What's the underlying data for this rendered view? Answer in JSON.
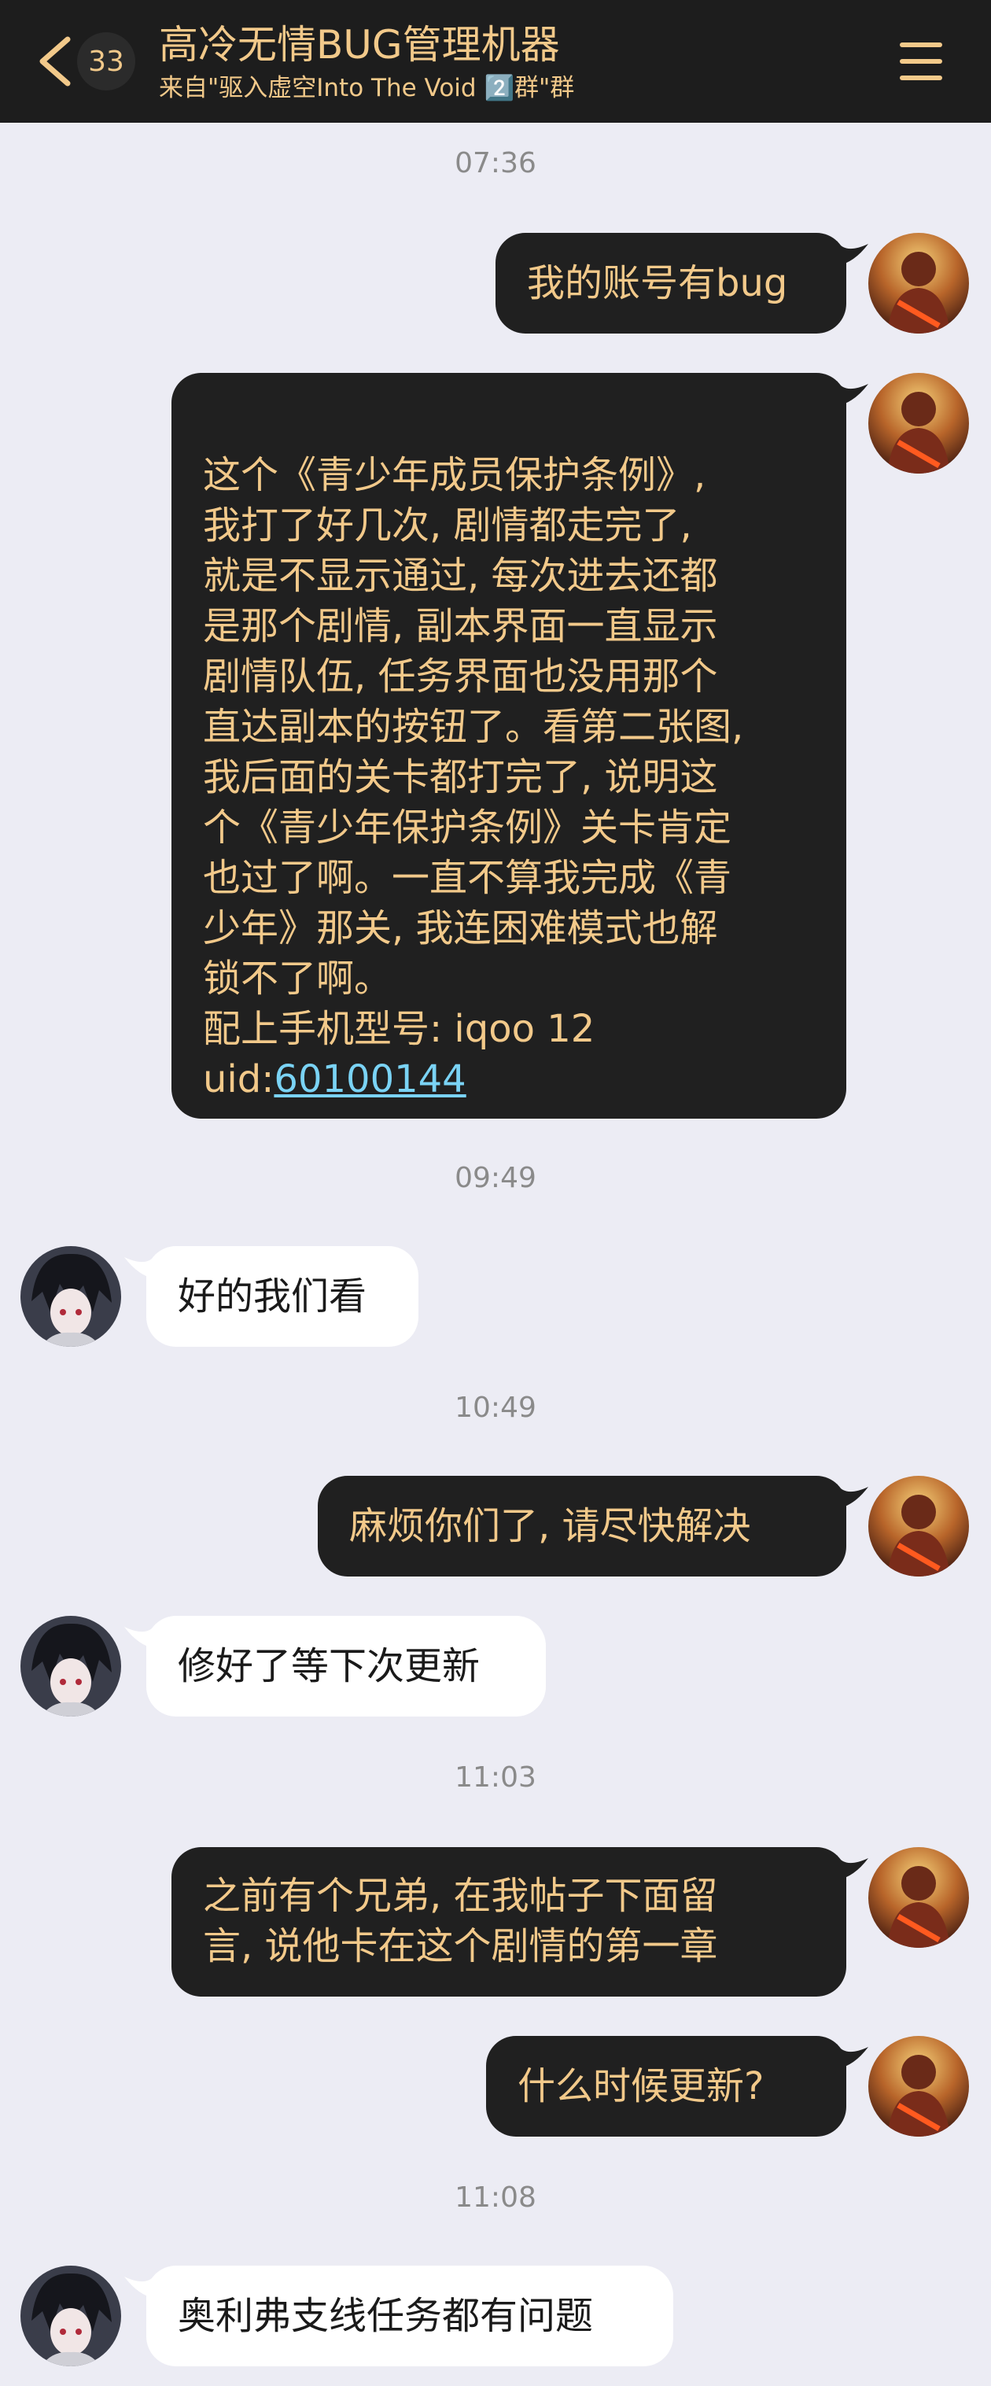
{
  "header": {
    "unread_count": "33",
    "title": "高冷无情BUG管理机器",
    "subtitle": "来自\"驱入虚空Into The Void 2️⃣群\"群"
  },
  "timestamps": [
    "07:36",
    "09:49",
    "10:49",
    "11:03",
    "11:08"
  ],
  "messages": [
    {
      "text": "我的账号有bug"
    },
    {
      "lines": [
        "这个《青少年成员保护条例》,",
        "我打了好几次, 剧情都走完了,",
        "就是不显示通过, 每次进去还都",
        "是那个剧情, 副本界面一直显示",
        "剧情队伍, 任务界面也没用那个",
        "直达副本的按钮了。看第二张图,",
        "我后面的关卡都打完了, 说明这",
        "个《青少年保护条例》关卡肯定",
        "也过了啊。一直不算我完成《青",
        "少年》那关, 我连困难模式也解",
        "锁不了啊。",
        "配上手机型号: iqoo  12"
      ],
      "uid_label": "uid:",
      "uid_value": "60100144"
    },
    {
      "text": "好的我们看"
    },
    {
      "text": "麻烦你们了, 请尽快解决"
    },
    {
      "text": "修好了等下次更新"
    },
    {
      "lines": [
        "之前有个兄弟, 在我帖子下面留",
        "言, 说他卡在这个剧情的第一章"
      ]
    },
    {
      "text": "什么时候更新?"
    },
    {
      "text": "奥利弗支线任务都有问题"
    }
  ],
  "colors": {
    "header_bg": "#1d1d1d",
    "accent_gold": "#f2c98a",
    "chat_bg": "#ececf4",
    "outgoing_bubble": "#202020",
    "incoming_bubble": "#ffffff",
    "link": "#7ad3f5"
  },
  "icons": [
    "chevron-left-icon",
    "menu-icon"
  ]
}
